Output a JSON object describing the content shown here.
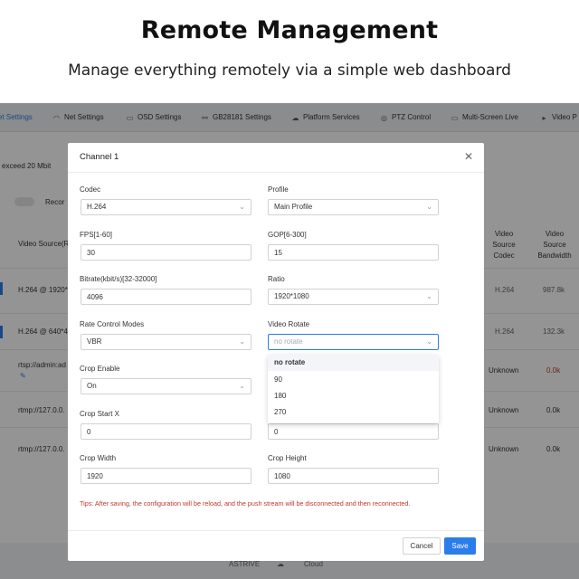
{
  "hero": {
    "title": "Remote Management",
    "subtitle": "Manage everything remotely via a simple web dashboard"
  },
  "nav": {
    "items": [
      {
        "label": "et Settings",
        "icon": "settings-icon"
      },
      {
        "label": "Net Settings",
        "icon": "wifi-icon"
      },
      {
        "label": "OSD Settings",
        "icon": "osd-icon"
      },
      {
        "label": "GB28181 Settings",
        "icon": "link-icon"
      },
      {
        "label": "Platform Services",
        "icon": "cloud-icon"
      },
      {
        "label": "PTZ Control",
        "icon": "target-icon"
      },
      {
        "label": "Multi-Screen Live",
        "icon": "monitor-icon"
      },
      {
        "label": "Video P",
        "icon": "video-icon"
      }
    ]
  },
  "background": {
    "notice": "exceed 20 Mbit",
    "record": "Recor",
    "col_video_source": "Video Source(R",
    "col_codec": "Video Source Codec",
    "col_bandwidth": "Video Source Bandwidth",
    "rows": [
      {
        "source": "H.264 @ 1920*",
        "codec": "H.264",
        "bandwidth": "987.8k"
      },
      {
        "source": "H.264 @ 640*4",
        "codec": "H.264",
        "bandwidth": "132.3k"
      },
      {
        "source": "rtsp://admin:ad",
        "codec": "Unknown",
        "bandwidth": "0.0k"
      },
      {
        "source": "rtmp://127.0.0.",
        "codec": "Unknown",
        "bandwidth": "0.0k"
      },
      {
        "source": "rtmp://127.0.0.",
        "codec": "Unknown",
        "bandwidth": "0.0k"
      }
    ],
    "footer_a": "ASTRIVE",
    "footer_b": "Cloud"
  },
  "modal": {
    "title": "Channel 1",
    "fields": {
      "codec": {
        "label": "Codec",
        "value": "H.264"
      },
      "profile": {
        "label": "Profile",
        "value": "Main Profile"
      },
      "fps": {
        "label": "FPS[1-60]",
        "value": "30"
      },
      "gop": {
        "label": "GOP[6-300]",
        "value": "15"
      },
      "bitrate": {
        "label": "Bitrate(kbit/s)[32-32000]",
        "value": "4096"
      },
      "ratio": {
        "label": "Ratio",
        "value": "1920*1080"
      },
      "rate_control": {
        "label": "Rate Control Modes",
        "value": "VBR"
      },
      "video_rotate": {
        "label": "Video Rotate",
        "placeholder": "no rotate"
      },
      "crop_enable": {
        "label": "Crop Enable",
        "value": "On"
      },
      "crop_start_x": {
        "label": "Crop Start X",
        "value": "0"
      },
      "crop_start_y": {
        "value": "0"
      },
      "crop_width": {
        "label": "Crop Width",
        "value": "1920"
      },
      "crop_height": {
        "label": "Crop Height",
        "value": "1080"
      }
    },
    "rotate_options": [
      "no rotate",
      "90",
      "180",
      "270"
    ],
    "tips": "Tips: After saving, the configuration will be reload, and the push stream will be disconnected and then reconnected.",
    "cancel_label": "Cancel",
    "save_label": "Save"
  },
  "colors": {
    "accent": "#2b7de9",
    "tip": "#c0392b"
  }
}
